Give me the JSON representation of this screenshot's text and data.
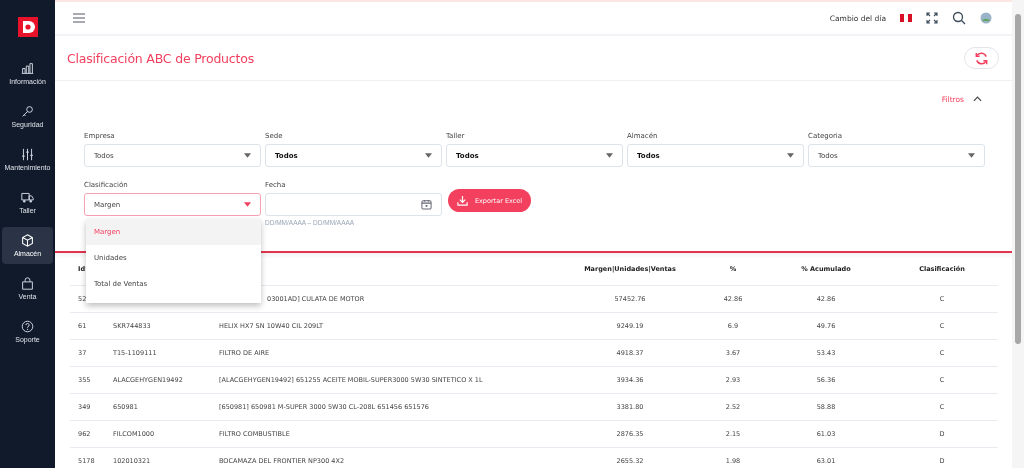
{
  "sidebar": {
    "items": [
      {
        "label": "Información",
        "selected": false
      },
      {
        "label": "Seguridad",
        "selected": false
      },
      {
        "label": "Mantenimiento",
        "selected": false
      },
      {
        "label": "Taller",
        "selected": false
      },
      {
        "label": "Almacén",
        "selected": true
      },
      {
        "label": "Venta",
        "selected": false
      },
      {
        "label": "Soporte",
        "selected": false
      }
    ]
  },
  "topbar": {
    "exchange_label": "Cambio del día"
  },
  "page": {
    "title": "Clasificación ABC de Productos"
  },
  "filters": {
    "toggle_label": "Filtros",
    "expanded": true,
    "fields": [
      {
        "label": "Empresa",
        "value": "Todos",
        "bold": false
      },
      {
        "label": "Sede",
        "value": "Todos",
        "bold": true
      },
      {
        "label": "Taller",
        "value": "Todos",
        "bold": true
      },
      {
        "label": "Almacén",
        "value": "Todos",
        "bold": true
      },
      {
        "label": "Categoria",
        "value": "Todos",
        "bold": false
      }
    ],
    "classification": {
      "label": "Clasificación",
      "value": "Margen",
      "open": true,
      "options": [
        {
          "label": "Margen",
          "selected": true
        },
        {
          "label": "Unidades",
          "selected": false
        },
        {
          "label": "Total de Ventas",
          "selected": false
        }
      ]
    },
    "date": {
      "label": "Fecha",
      "hint": "DD/MM/AAAA – DD/MM/AAAA"
    },
    "export_button": "Exportar Excel"
  },
  "table": {
    "columns": [
      "Id",
      null,
      null,
      "Margen|Unidades|Ventas",
      "%",
      "% Acumulado",
      "Clasificación"
    ],
    "rows": [
      [
        "52",
        null,
        "03001AD] CULATA DE MOTOR",
        "57452.76",
        "42.86",
        "42.86",
        "C"
      ],
      [
        "61",
        "SKR744833",
        "HELIX HX7 SN 10W40 CIL 209LT",
        "9249.19",
        "6.9",
        "49.76",
        "C"
      ],
      [
        "37",
        "T15-1109111",
        "FILTRO DE AIRE",
        "4918.37",
        "3.67",
        "53.43",
        "C"
      ],
      [
        "355",
        "ALACGEHYGEN19492",
        "[ALACGEHYGEN19492] 651255 ACEITE MOBIL-SUPER3000 5W30 SINTETICO X 1L",
        "3934.36",
        "2.93",
        "56.36",
        "C"
      ],
      [
        "349",
        "650981",
        "[650981] 650981 M-SUPER 3000 5W30 CL-208L 651456 651576",
        "3381.80",
        "2.52",
        "58.88",
        "C"
      ],
      [
        "962",
        "FILCOM1000",
        "FILTRO COMBUSTIBLE",
        "2876.35",
        "2.15",
        "61.03",
        "D"
      ],
      [
        "5178",
        "102010321",
        "BOCAMAZA DEL FRONTIER NP300 4X2",
        "2655.32",
        "1.98",
        "63.01",
        "D"
      ]
    ]
  }
}
